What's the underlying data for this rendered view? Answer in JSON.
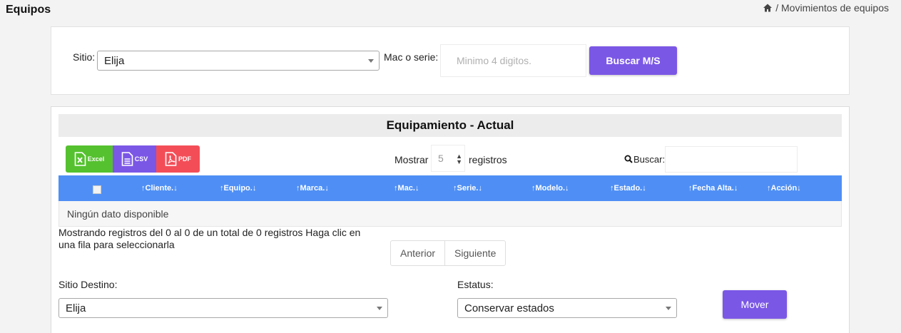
{
  "page": {
    "title": "Equipos",
    "breadcrumb": "/ Movimientos de equipos"
  },
  "search_card": {
    "sitio_label": "Sitio:",
    "sitio_value": "Elija",
    "mac_label": "Mac o serie:",
    "mac_placeholder": "Minimo 4 digitos.",
    "search_button": "Buscar M/S"
  },
  "table_card": {
    "header": "Equipamiento - Actual",
    "export": {
      "excel": "Excel",
      "csv": "CSV",
      "pdf": "PDF"
    },
    "show_label": "Mostrar",
    "show_value": "5",
    "records_label": "registros",
    "search_label": "Buscar:",
    "columns": [
      "↑Cliente.↓",
      "↑Equipo.↓",
      "↑Marca.↓",
      "↑Mac.↓",
      "↑Serie.↓",
      "↑Modelo.↓",
      "↑Estado.↓",
      "↑Fecha Alta.↓",
      "↑Acción↓"
    ],
    "empty_message": "Ningún dato disponible",
    "info_text": "Mostrando registros del 0 al 0 de un total de 0 registros    Haga clic en una fila para seleccionarla",
    "pager": {
      "prev": "Anterior",
      "next": "Siguiente"
    },
    "destino_label": "Sitio Destino:",
    "destino_value": "Elija",
    "estatus_label": "Estatus:",
    "estatus_value": "Conservar estados",
    "move_button": "Mover"
  },
  "colors": {
    "accent": "#7b57e6",
    "table_header": "#4f8ff5",
    "excel": "#55c12f",
    "pdf": "#f34e58"
  }
}
